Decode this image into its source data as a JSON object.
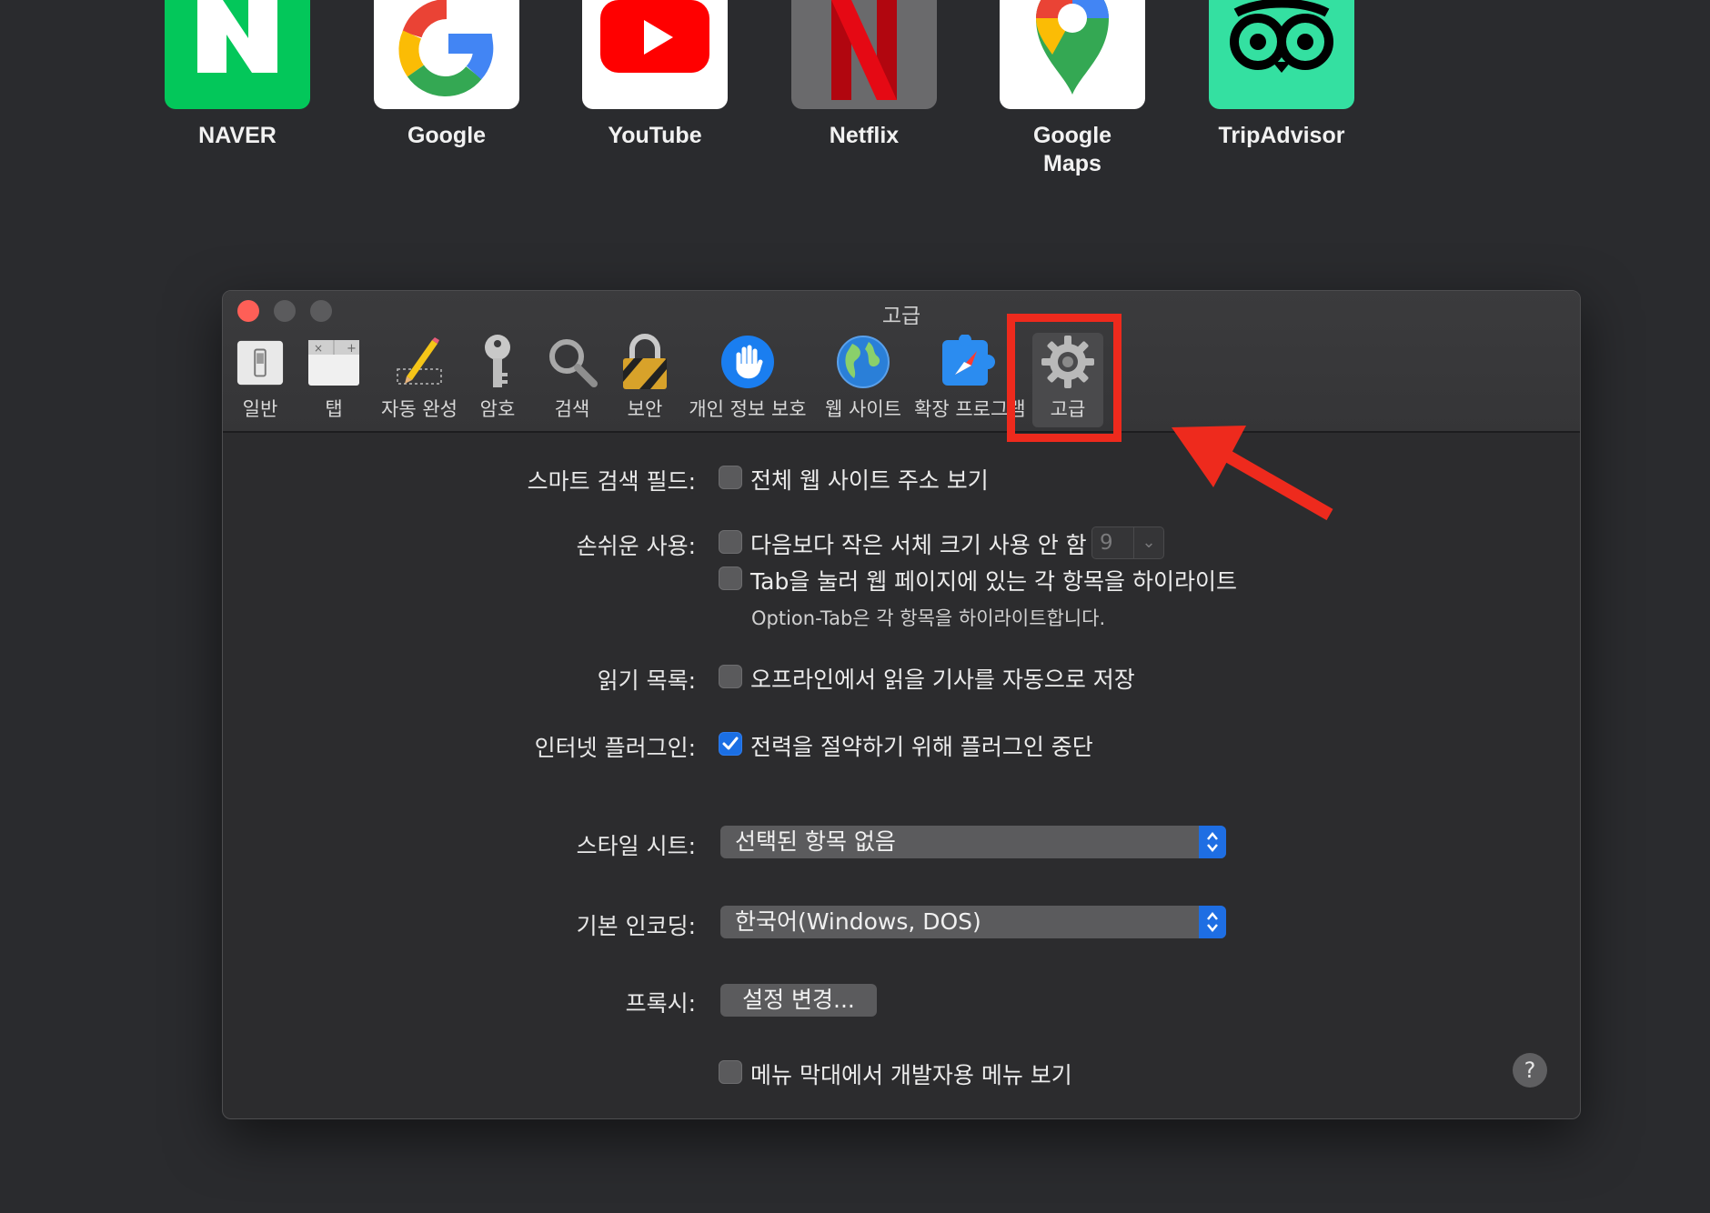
{
  "favorites": [
    {
      "label": "NAVER",
      "icon": "naver-icon",
      "color": "#03c75a"
    },
    {
      "label": "Google",
      "icon": "google-icon",
      "color": "#ffffff"
    },
    {
      "label": "YouTube",
      "icon": "youtube-icon",
      "color": "#ffffff"
    },
    {
      "label": "Netflix",
      "icon": "netflix-icon",
      "color": "#6a6a6c"
    },
    {
      "label": "Google\nMaps",
      "icon": "google-maps-icon",
      "color": "#ffffff"
    },
    {
      "label": "TripAdvisor",
      "icon": "tripadvisor-icon",
      "color": "#34e0a1"
    }
  ],
  "window": {
    "title": "고급",
    "toolbar": [
      {
        "label": "일반",
        "icon": "general-switch-icon"
      },
      {
        "label": "탭",
        "icon": "tabs-icon"
      },
      {
        "label": "자동 완성",
        "icon": "pencil-icon"
      },
      {
        "label": "암호",
        "icon": "key-icon"
      },
      {
        "label": "검색",
        "icon": "magnifier-icon"
      },
      {
        "label": "보안",
        "icon": "lock-icon"
      },
      {
        "label": "개인 정보 보호",
        "icon": "hand-icon"
      },
      {
        "label": "웹 사이트",
        "icon": "globe-icon"
      },
      {
        "label": "확장 프로그램",
        "icon": "extensions-icon"
      },
      {
        "label": "고급",
        "icon": "gear-icon",
        "selected": true
      }
    ]
  },
  "form": {
    "smart_search": {
      "label": "스마트 검색 필드:",
      "option": "전체 웹 사이트 주소 보기",
      "checked": false
    },
    "accessibility": {
      "label": "손쉬운 사용:",
      "option1": "다음보다 작은 서체 크기 사용 안 함",
      "font_size": "9",
      "option2": "Tab을 눌러 웹 페이지에 있는 각 항목을 하이라이트",
      "hint": "Option-Tab은 각 항목을 하이라이트합니다."
    },
    "reading_list": {
      "label": "읽기 목록:",
      "option": "오프라인에서 읽을 기사를 자동으로 저장",
      "checked": false
    },
    "plugins": {
      "label": "인터넷 플러그인:",
      "option": "전력을 절약하기 위해 플러그인 중단",
      "checked": true
    },
    "style_sheet": {
      "label": "스타일 시트:",
      "value": "선택된 항목 없음"
    },
    "encoding": {
      "label": "기본 인코딩:",
      "value": "한국어(Windows, DOS)"
    },
    "proxy": {
      "label": "프록시:",
      "button": "설정 변경..."
    },
    "develop_menu": {
      "option": "메뉴 막대에서 개발자용 메뉴 보기",
      "checked": false
    },
    "help": "?"
  },
  "colors": {
    "annotation": "#ee2a1d",
    "accent": "#1b6fe4"
  }
}
